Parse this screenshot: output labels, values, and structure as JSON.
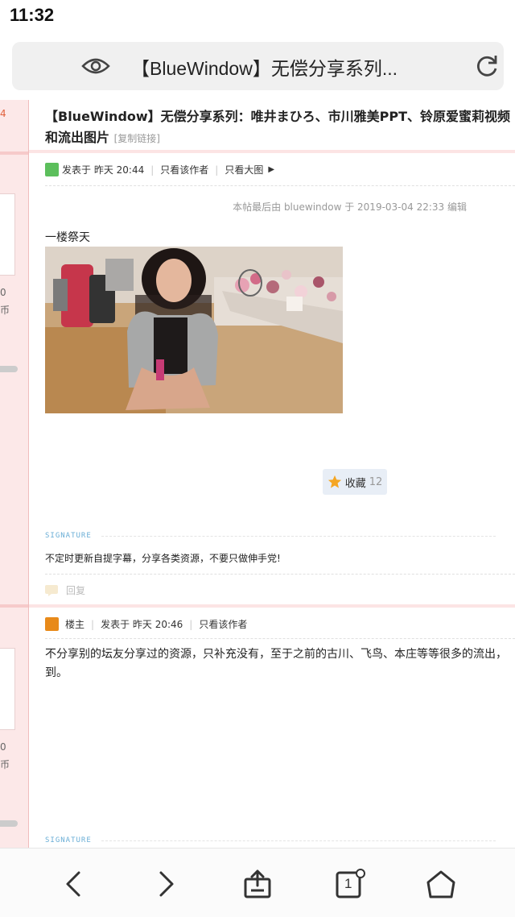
{
  "status_bar": {
    "time": "11:32"
  },
  "url_bar": {
    "title": "【BlueWindow】无偿分享系列..."
  },
  "left_column": {
    "badge_number": "4",
    "value_a": "0",
    "unit_a": "币",
    "value_b": "0",
    "unit_b": "币"
  },
  "thread": {
    "title": "【BlueWindow】无偿分享系列：唯井まひろ、市川雅美PPT、铃原爱蜜莉视频和流出图片",
    "copy_link": "[复制链接]"
  },
  "post1": {
    "posted": "发表于 昨天 20:44",
    "only_author": "只看该作者",
    "only_big_image": "只看大图",
    "edit_note": "本帖最后由 bluewindow 于 2019-03-04 22:33 编辑",
    "floor_text": "一楼祭天",
    "favorite_label": "收藏",
    "favorite_count": "12",
    "signature_label": "SIGNATURE",
    "signature_text": "不定时更新自提字幕，分享各类资源，不要只做伸手党!",
    "reply_label": "回复"
  },
  "post2": {
    "owner_label": "楼主",
    "posted": "发表于 昨天 20:46",
    "only_author": "只看该作者",
    "body": "不分享别的坛友分享过的资源，只补充没有，至于之前的古川、飞鸟、本庄等等很多的流出，到。",
    "signature_label": "SIGNATURE"
  },
  "bottom_nav": {
    "tabs_count": "1"
  },
  "colors": {
    "accent_pink": "#fce4e4",
    "signature_blue": "#6aaed6"
  },
  "icons": [
    "eye-icon",
    "reload-icon",
    "back-icon",
    "forward-icon",
    "share-icon",
    "tabs-icon",
    "home-icon",
    "star-icon",
    "avatar-icon",
    "reply-icon"
  ]
}
